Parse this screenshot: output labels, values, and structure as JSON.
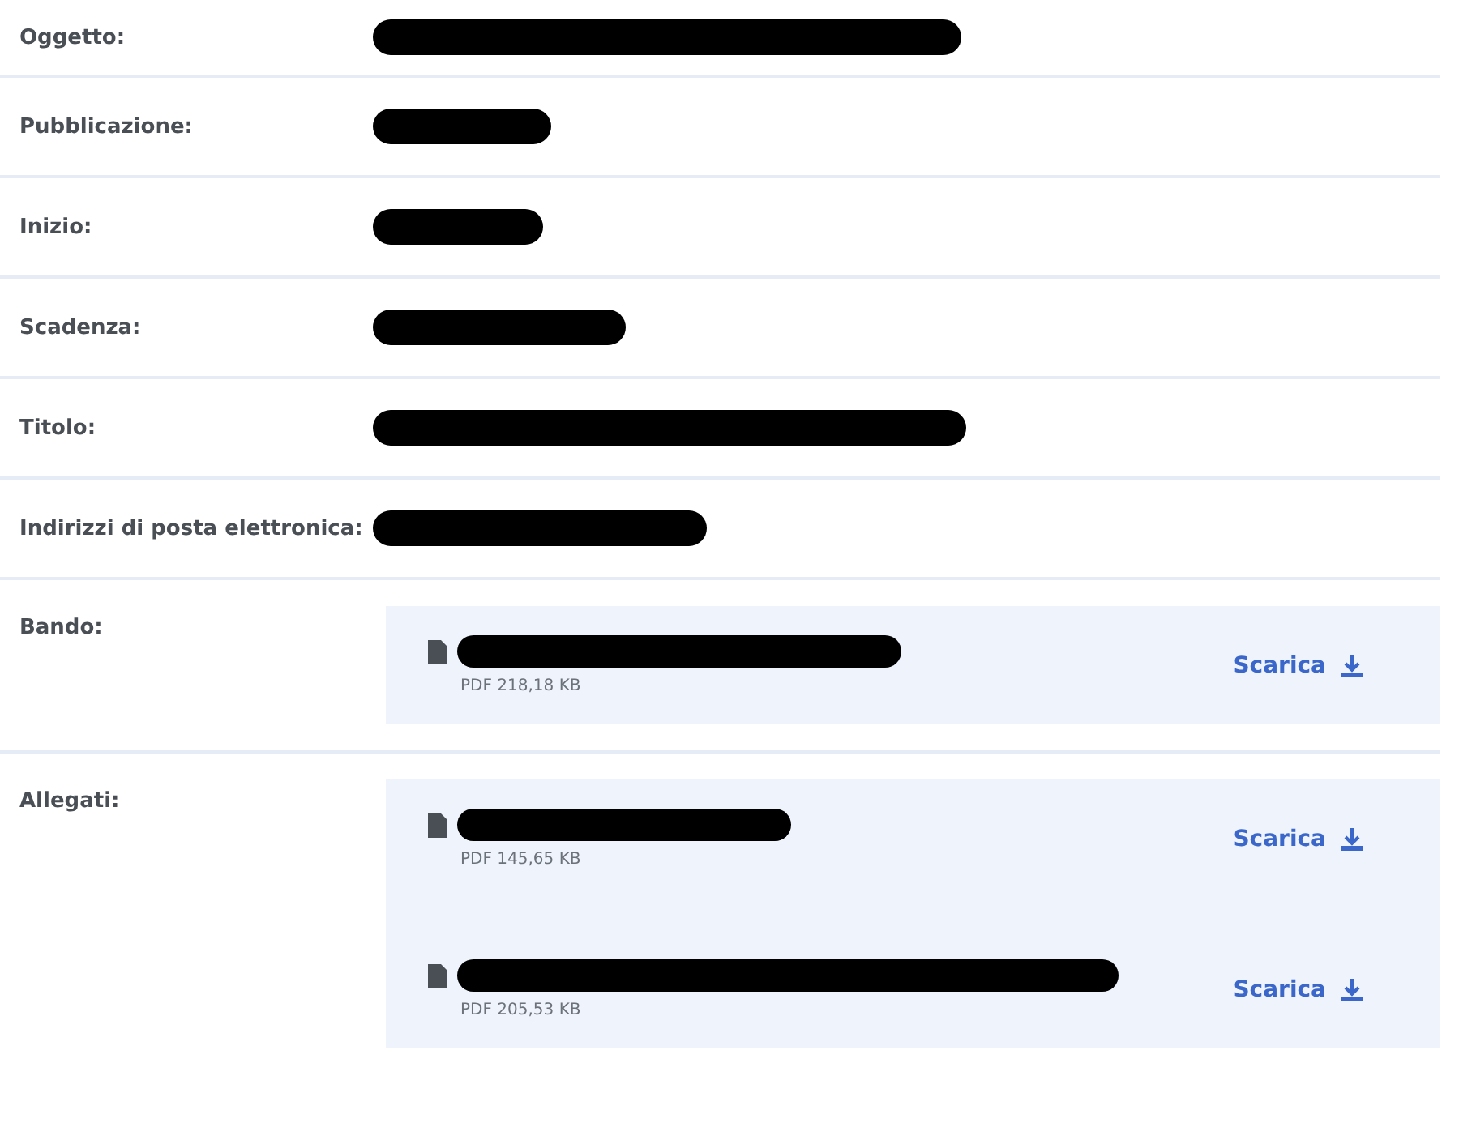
{
  "fields": [
    {
      "label": "Oggetto:",
      "redacted": true
    },
    {
      "label": "Pubblicazione:",
      "redacted": true
    },
    {
      "label": "Inizio:",
      "redacted": true
    },
    {
      "label": "Scadenza:",
      "redacted": true
    },
    {
      "label": "Titolo:",
      "redacted": true
    },
    {
      "label": "Indirizzi di posta elettronica:",
      "redacted": true
    }
  ],
  "attachment_groups": [
    {
      "label": "Bando:",
      "files": [
        {
          "redacted": true,
          "meta": "PDF 218,18 KB",
          "action": "Scarica"
        }
      ]
    },
    {
      "label": "Allegati:",
      "files": [
        {
          "redacted": true,
          "meta": "PDF 145,65 KB",
          "action": "Scarica"
        },
        {
          "redacted": true,
          "meta": "PDF 205,53 KB",
          "action": "Scarica"
        }
      ]
    }
  ]
}
